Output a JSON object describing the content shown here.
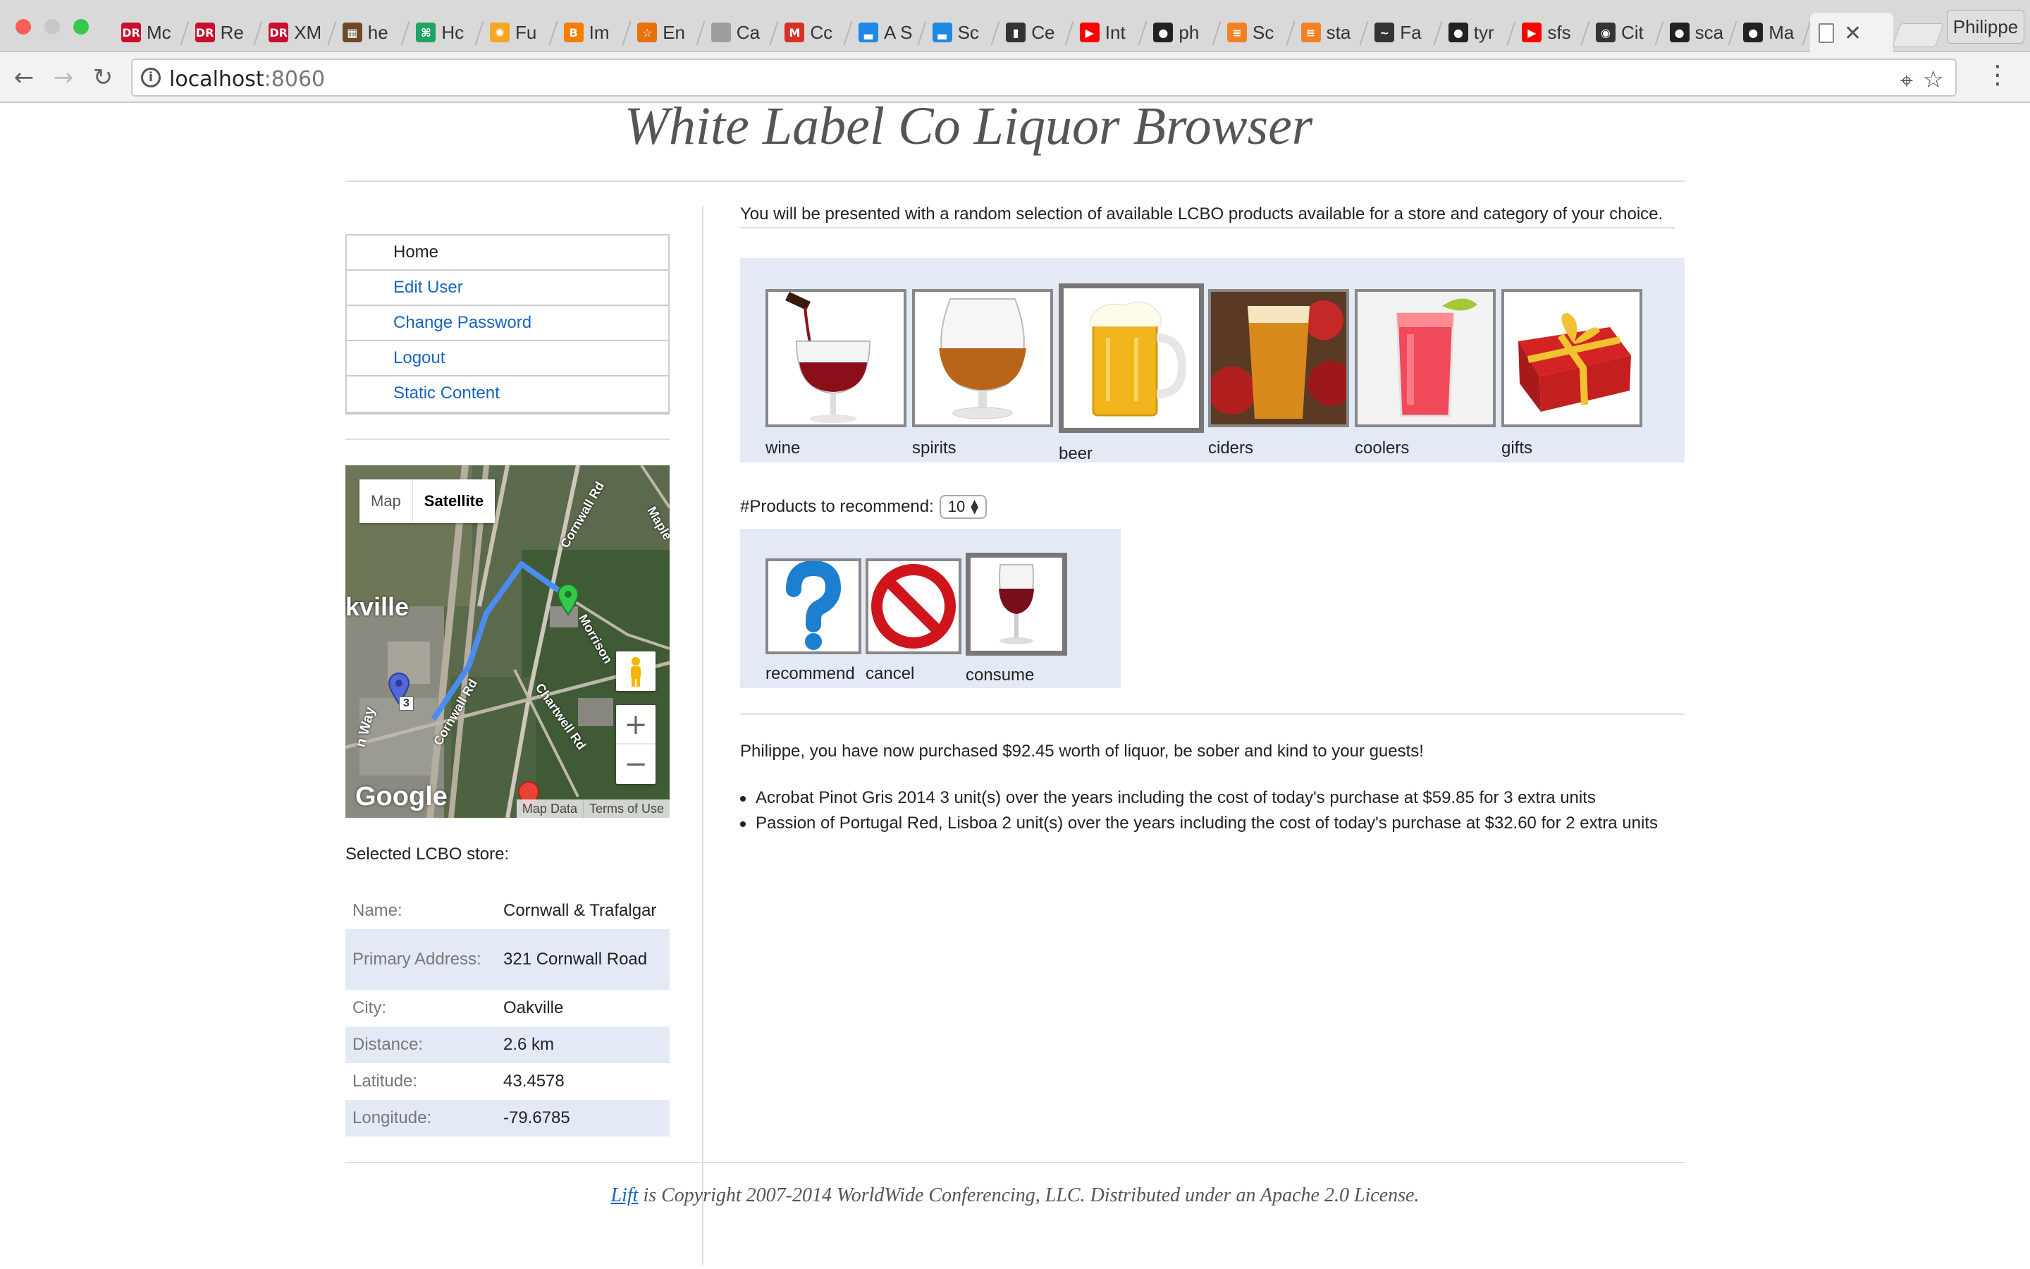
{
  "browser": {
    "tabs": [
      {
        "title": "Mc",
        "icon": "dr-icon",
        "color": "#c8102e"
      },
      {
        "title": "Re",
        "icon": "dr-icon",
        "color": "#c8102e"
      },
      {
        "title": "XM",
        "icon": "dr-icon",
        "color": "#c8102e"
      },
      {
        "title": "he",
        "icon": "photo-icon",
        "color": "#6b4a2a"
      },
      {
        "title": "Hc",
        "icon": "leaf-icon",
        "color": "#1fa463"
      },
      {
        "title": "Fu",
        "icon": "sun-icon",
        "color": "#f5a623"
      },
      {
        "title": "Im",
        "icon": "blogger-icon",
        "color": "#f57d00"
      },
      {
        "title": "En",
        "icon": "star-icon",
        "color": "#e8710a"
      },
      {
        "title": "Ca",
        "icon": "page-icon",
        "color": "#9e9e9e"
      },
      {
        "title": "Cc",
        "icon": "gmail-icon",
        "color": "#d93025"
      },
      {
        "title": "A S",
        "icon": "chart-icon",
        "color": "#1e88e5"
      },
      {
        "title": "Sc",
        "icon": "chart-icon",
        "color": "#1e88e5"
      },
      {
        "title": "Ce",
        "icon": "book-icon",
        "color": "#333333"
      },
      {
        "title": "Int",
        "icon": "youtube-icon",
        "color": "#ff0000"
      },
      {
        "title": "ph",
        "icon": "github-icon",
        "color": "#222222"
      },
      {
        "title": "Sc",
        "icon": "stackoverflow-icon",
        "color": "#f48024"
      },
      {
        "title": "sta",
        "icon": "stackoverflow-icon",
        "color": "#f48024"
      },
      {
        "title": "Fa",
        "icon": "terminal-icon",
        "color": "#333333"
      },
      {
        "title": "tyr",
        "icon": "github-icon",
        "color": "#222222"
      },
      {
        "title": "sfs",
        "icon": "youtube-icon",
        "color": "#ff0000"
      },
      {
        "title": "Cit",
        "icon": "camera-icon",
        "color": "#333333"
      },
      {
        "title": "sca",
        "icon": "github-icon",
        "color": "#222222"
      },
      {
        "title": "Ma",
        "icon": "github-icon",
        "color": "#222222"
      }
    ],
    "profile": "Philippe",
    "url_host": "localhost",
    "url_port": ":8060"
  },
  "site": {
    "title": "White Label Co Liquor Browser"
  },
  "menu": [
    {
      "label": "Home"
    },
    {
      "label": "Edit User"
    },
    {
      "label": "Change Password"
    },
    {
      "label": "Logout"
    },
    {
      "label": "Static Content"
    }
  ],
  "map": {
    "toggle_map": "Map",
    "toggle_satellite": "Satellite",
    "selected_mode": "Satellite",
    "zoom_in": "+",
    "zoom_out": "−",
    "logo": "Google",
    "map_data": "Map Data",
    "terms": "Terms of Use",
    "labels": {
      "town": "kville",
      "cornwall_rd_north": "Cornwall Rd",
      "cornwall_rd_south": "Cornwall Rd",
      "chartwell_rd": "Chartwell Rd",
      "morrison": "Morrison",
      "maple": "Maple",
      "route": "3",
      "way": "n Way"
    }
  },
  "store": {
    "label": "Selected LCBO store:",
    "rows": [
      {
        "key": "Name:",
        "value": "Cornwall & Trafalgar"
      },
      {
        "key": "Primary Address:",
        "value": "321 Cornwall Road"
      },
      {
        "key": "City:",
        "value": "Oakville"
      },
      {
        "key": "Distance:",
        "value": "2.6 km"
      },
      {
        "key": "Latitude:",
        "value": "43.4578"
      },
      {
        "key": "Longitude:",
        "value": "-79.6785"
      }
    ]
  },
  "main": {
    "intro": "You will be presented with a random selection of available LCBO products available for a store and category of your choice.",
    "categories": [
      {
        "label": "wine",
        "selected": false
      },
      {
        "label": "spirits",
        "selected": false
      },
      {
        "label": "beer",
        "selected": true
      },
      {
        "label": "ciders",
        "selected": false
      },
      {
        "label": "coolers",
        "selected": false
      },
      {
        "label": "gifts",
        "selected": false
      }
    ],
    "count_label": "#Products to recommend:",
    "count_value": "10",
    "actions": [
      {
        "label": "recommend",
        "selected": false
      },
      {
        "label": "cancel",
        "selected": false
      },
      {
        "label": "consume",
        "selected": true
      }
    ],
    "purchase_message": "Philippe, you have now purchased $92.45 worth of liquor, be sober and kind to your guests!",
    "purchases": [
      "Acrobat Pinot Gris 2014 3 unit(s) over the years including the cost of today's purchase at $59.85 for 3 extra units",
      "Passion of Portugal Red, Lisboa 2 unit(s) over the years including the cost of today's purchase at $32.60 for 2 extra units"
    ]
  },
  "footer": {
    "link": "Lift",
    "text": " is Copyright 2007-2014 WorldWide Conferencing, LLC. Distributed under an Apache 2.0 License."
  }
}
